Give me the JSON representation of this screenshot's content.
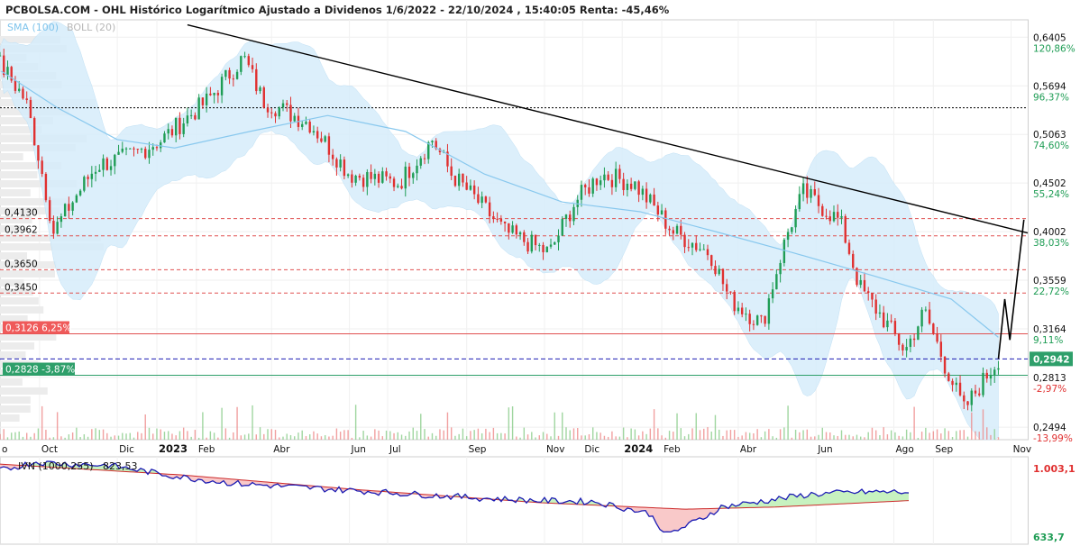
{
  "title": "PCBOLSA.COM - OHL Histórico Logarítmico Ajustado a Dividenos 1/6/2022 - 22/10/2024 , 15:40:05 Renta: -45,46%",
  "legend": {
    "sma": "SMA (100)",
    "boll": "BOLL (20)"
  },
  "colors": {
    "up": "#1f9d55",
    "down": "#e03030",
    "sma": "#88c8ee",
    "band": "#d6ecfa",
    "trend": "#000000",
    "current": "#2e9f6a",
    "support": "#2e9f6a",
    "resistance": "#e05050",
    "ivn": "#1c1cb4",
    "ivn_ma": "#cc2a2a",
    "ivn_below": "#f9c9c9",
    "ivn_above": "#c7f2c0"
  },
  "price_axis": {
    "ticks": [
      {
        "label": "0,6405",
        "pct": "120,86%",
        "value": 0.6405
      },
      {
        "label": "0,5694",
        "pct": "96,37%",
        "value": 0.5694
      },
      {
        "label": "0,5063",
        "pct": "74,60%",
        "value": 0.5063
      },
      {
        "label": "0,4502",
        "pct": "55,24%",
        "value": 0.4502
      },
      {
        "label": "0,4002",
        "pct": "38,03%",
        "value": 0.4002
      },
      {
        "label": "0,3559",
        "pct": "22,72%",
        "value": 0.3559
      },
      {
        "label": "0,3164",
        "pct": "9,11%",
        "value": 0.3164
      },
      {
        "label": "0,2813",
        "pct": "-2,97%",
        "value": 0.2813
      },
      {
        "label": "0,2494",
        "pct": "-13,99%",
        "value": 0.2494
      }
    ],
    "current_label": "0,2942",
    "current_value": 0.2942
  },
  "levels": [
    {
      "label": "0,4130",
      "value": 0.413
    },
    {
      "label": "0,3962",
      "value": 0.3962
    },
    {
      "label": "0,3650",
      "value": 0.365
    },
    {
      "label": "0,3450",
      "value": 0.345
    }
  ],
  "tags": {
    "resistance": {
      "label": "0,3126  6,25%",
      "value": 0.3126
    },
    "support": {
      "label": "0,2828  -3,87%",
      "value": 0.2828
    }
  },
  "x_axis": [
    {
      "label": "o",
      "date": "2022-08-31",
      "year": false
    },
    {
      "label": "Oct",
      "date": "2022-10-01",
      "year": false
    },
    {
      "label": "Dic",
      "date": "2022-12-01",
      "year": false
    },
    {
      "label": "2023",
      "date": "2023-01-01",
      "year": true
    },
    {
      "label": "Feb",
      "date": "2023-02-01",
      "year": false
    },
    {
      "label": "Abr",
      "date": "2023-04-01",
      "year": false
    },
    {
      "label": "Jun",
      "date": "2023-06-01",
      "year": false
    },
    {
      "label": "Jul",
      "date": "2023-07-01",
      "year": false
    },
    {
      "label": "Sep",
      "date": "2023-09-01",
      "year": false
    },
    {
      "label": "Nov",
      "date": "2023-11-01",
      "year": false
    },
    {
      "label": "Dic",
      "date": "2023-12-01",
      "year": false
    },
    {
      "label": "2024",
      "date": "2024-01-01",
      "year": true
    },
    {
      "label": "Feb",
      "date": "2024-02-01",
      "year": false
    },
    {
      "label": "Abr",
      "date": "2024-04-01",
      "year": false
    },
    {
      "label": "Jun",
      "date": "2024-06-01",
      "year": false
    },
    {
      "label": "Ago",
      "date": "2024-08-01",
      "year": false
    },
    {
      "label": "Sep",
      "date": "2024-09-01",
      "year": false
    },
    {
      "label": "Nov",
      "date": "2024-11-01",
      "year": false
    }
  ],
  "ivn": {
    "label": "IVN (1000,255)",
    "value": "823,53",
    "max_label": "1.003,1",
    "min_label": "633,7",
    "max": 1003.1,
    "min": 633.7
  },
  "chart_data": {
    "type": "candlestick",
    "title": "PCBOLSA.COM - OHL Histórico Logarítmico Ajustado a Dividenos 1/6/2022 - 22/10/2024 , 15:40:05 Renta: -45,46%",
    "scale": "log",
    "x_range": [
      "2022-08-31",
      "2024-11-14"
    ],
    "y_range": [
      0.242,
      0.668
    ],
    "grid": true,
    "price_path": [
      [
        "2022-08-31",
        0.6
      ],
      [
        "2022-09-20",
        0.55
      ],
      [
        "2022-10-12",
        0.4
      ],
      [
        "2022-11-15",
        0.47
      ],
      [
        "2022-12-10",
        0.48
      ],
      [
        "2023-01-05",
        0.5
      ],
      [
        "2023-02-10",
        0.55
      ],
      [
        "2023-03-10",
        0.61
      ],
      [
        "2023-03-25",
        0.55
      ],
      [
        "2023-05-01",
        0.52
      ],
      [
        "2023-06-01",
        0.46
      ],
      [
        "2023-07-10",
        0.45
      ],
      [
        "2023-08-05",
        0.5
      ],
      [
        "2023-08-20",
        0.46
      ],
      [
        "2023-10-01",
        0.4
      ],
      [
        "2023-11-05",
        0.38
      ],
      [
        "2023-11-25",
        0.43
      ],
      [
        "2023-12-15",
        0.46
      ],
      [
        "2024-01-10",
        0.45
      ],
      [
        "2024-02-10",
        0.4
      ],
      [
        "2024-03-10",
        0.38
      ],
      [
        "2024-03-25",
        0.34
      ],
      [
        "2024-04-20",
        0.32
      ],
      [
        "2024-05-10",
        0.4
      ],
      [
        "2024-05-22",
        0.44
      ],
      [
        "2024-06-20",
        0.41
      ],
      [
        "2024-07-05",
        0.35
      ],
      [
        "2024-08-10",
        0.3
      ],
      [
        "2024-08-25",
        0.33
      ],
      [
        "2024-09-10",
        0.29
      ],
      [
        "2024-09-25",
        0.26
      ],
      [
        "2024-10-22",
        0.2942
      ]
    ],
    "sma_100": [
      [
        "2022-09-01",
        0.59
      ],
      [
        "2022-10-15",
        0.54
      ],
      [
        "2022-12-01",
        0.5
      ],
      [
        "2023-01-15",
        0.49
      ],
      [
        "2023-03-15",
        0.51
      ],
      [
        "2023-05-15",
        0.53
      ],
      [
        "2023-07-15",
        0.51
      ],
      [
        "2023-09-15",
        0.46
      ],
      [
        "2023-11-15",
        0.43
      ],
      [
        "2024-01-15",
        0.42
      ],
      [
        "2024-03-15",
        0.4
      ],
      [
        "2024-05-15",
        0.38
      ],
      [
        "2024-07-15",
        0.36
      ],
      [
        "2024-09-15",
        0.34
      ],
      [
        "2024-10-22",
        0.31
      ]
    ],
    "projection": [
      [
        "2024-10-22",
        0.2942
      ],
      [
        "2024-10-27",
        0.34
      ],
      [
        "2024-10-31",
        0.308
      ],
      [
        "2024-11-11",
        0.412
      ]
    ],
    "trendline": [
      [
        "2023-01-25",
        0.66
      ],
      [
        "2024-11-14",
        0.399
      ]
    ],
    "volume_profile": true
  }
}
